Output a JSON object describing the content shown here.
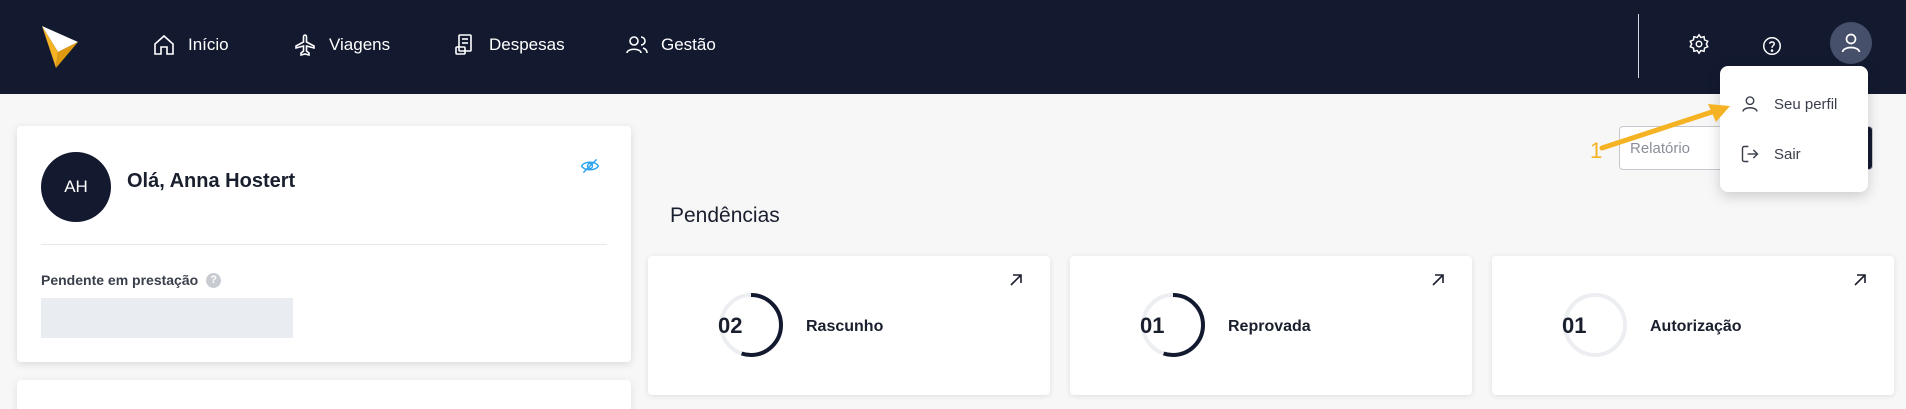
{
  "nav": {
    "items": [
      {
        "label": "Início",
        "icon": "home-icon"
      },
      {
        "label": "Viagens",
        "icon": "plane-icon"
      },
      {
        "label": "Despesas",
        "icon": "receipt-icon"
      },
      {
        "label": "Gestão",
        "icon": "users-icon"
      }
    ],
    "icons": {
      "settings": "gear-icon",
      "help": "help-icon",
      "user": "user-icon"
    }
  },
  "profile": {
    "initials": "AH",
    "greeting": "Olá, Anna Hostert",
    "pending_label": "Pendente em prestação",
    "help_badge": "?"
  },
  "report": {
    "label": "Relatório"
  },
  "pendencias": {
    "title": "Pendências",
    "cards": [
      {
        "count": "02",
        "label": "Rascunho",
        "progress": 0.55
      },
      {
        "count": "01",
        "label": "Reprovada",
        "progress": 0.55
      },
      {
        "count": "01",
        "label": "Autorização",
        "progress": 0.0
      }
    ]
  },
  "dropdown": {
    "items": [
      {
        "label": "Seu perfil"
      },
      {
        "label": "Sair"
      }
    ]
  },
  "annotation": {
    "number": "1"
  },
  "colors": {
    "nav_bg": "#131a30",
    "accent_yellow": "#f5b324",
    "eye_blue": "#2ea3f2",
    "ring_dark": "#131a30",
    "ring_light": "#eceef1"
  }
}
